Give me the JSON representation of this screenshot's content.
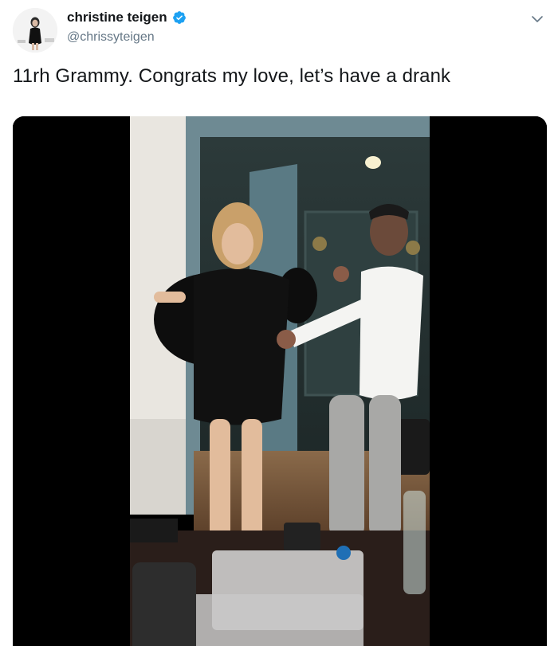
{
  "author": {
    "display_name": "christine teigen",
    "handle": "@chrissyteigen",
    "verified": true,
    "avatar_icon": "avatar-photo"
  },
  "tweet": {
    "text": "11rh Grammy. Congrats my love, let’s have a drank"
  },
  "menu": {
    "icon": "chevron-down-icon"
  },
  "media": {
    "type": "video",
    "poster_description_icon": "video-frame"
  },
  "colors": {
    "text": "#14171a",
    "secondary": "#657786",
    "verified_blue": "#1da1f2"
  }
}
